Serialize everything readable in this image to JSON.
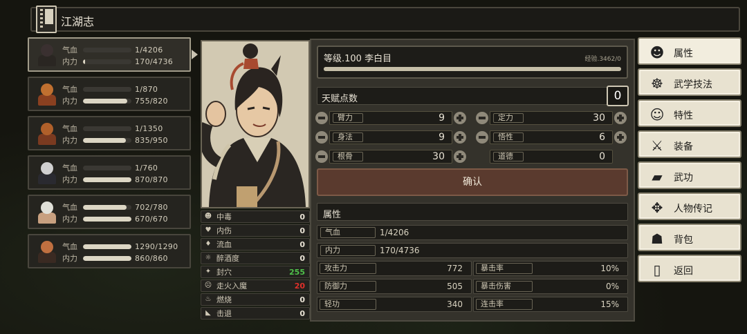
{
  "header": {
    "title": "江湖志"
  },
  "party": [
    {
      "hp_label": "气血",
      "hp": "1/4206",
      "hp_frac": 0.0,
      "mp_label": "内力",
      "mp": "170/4736",
      "mp_frac": 0.04,
      "colors": [
        "#3a3030",
        "#2a2622"
      ],
      "active": true
    },
    {
      "hp_label": "气血",
      "hp": "1/870",
      "hp_frac": 0.0,
      "mp_label": "内力",
      "mp": "755/820",
      "mp_frac": 0.92,
      "colors": [
        "#c07030",
        "#8a4020"
      ],
      "active": false
    },
    {
      "hp_label": "气血",
      "hp": "1/1350",
      "hp_frac": 0.0,
      "mp_label": "内力",
      "mp": "835/950",
      "mp_frac": 0.88,
      "colors": [
        "#b0602a",
        "#7a3a20"
      ],
      "active": false
    },
    {
      "hp_label": "气血",
      "hp": "1/760",
      "hp_frac": 0.0,
      "mp_label": "内力",
      "mp": "870/870",
      "mp_frac": 1.0,
      "colors": [
        "#d0d0d0",
        "#2a2a30"
      ],
      "active": false
    },
    {
      "hp_label": "气血",
      "hp": "702/780",
      "hp_frac": 0.9,
      "mp_label": "内力",
      "mp": "670/670",
      "mp_frac": 1.0,
      "colors": [
        "#e0e0d8",
        "#c8a080"
      ],
      "active": false
    },
    {
      "hp_label": "气血",
      "hp": "1290/1290",
      "hp_frac": 1.0,
      "mp_label": "内力",
      "mp": "860/860",
      "mp_frac": 1.0,
      "colors": [
        "#c07040",
        "#3a2a22"
      ],
      "active": false
    }
  ],
  "status": [
    {
      "icon": "poison-icon",
      "glyph": "☻",
      "label": "中毒",
      "value": "0",
      "color": "#e8e2d4"
    },
    {
      "icon": "injury-icon",
      "glyph": "♥",
      "label": "内伤",
      "value": "0",
      "color": "#e8e2d4"
    },
    {
      "icon": "bleed-icon",
      "glyph": "♦",
      "label": "流血",
      "value": "0",
      "color": "#e8e2d4"
    },
    {
      "icon": "drunk-icon",
      "glyph": "☼",
      "label": "醉酒度",
      "value": "0",
      "color": "#e8e2d4"
    },
    {
      "icon": "seal-icon",
      "glyph": "✦",
      "label": "封穴",
      "value": "255",
      "color": "#4fc04a"
    },
    {
      "icon": "qi-deviation-icon",
      "glyph": "☹",
      "label": "走火入魔",
      "value": "20",
      "color": "#e0302a"
    },
    {
      "icon": "burn-icon",
      "glyph": "♨",
      "label": "燃烧",
      "value": "0",
      "color": "#e8e2d4"
    },
    {
      "icon": "knockback-icon",
      "glyph": "◣",
      "label": "击退",
      "value": "0",
      "color": "#e8e2d4"
    }
  ],
  "main": {
    "level_text": "等级.100 李白目",
    "exp_text": "经验.3462/0",
    "exp_frac": 1.0,
    "talent_label": "天赋点数",
    "talent_value": "0",
    "stats": [
      {
        "label": "臂力",
        "value": "9"
      },
      {
        "label": "定力",
        "value": "30"
      },
      {
        "label": "身法",
        "value": "9"
      },
      {
        "label": "悟性",
        "value": "6"
      },
      {
        "label": "根骨",
        "value": "30"
      },
      {
        "label": "道德",
        "value": "0"
      }
    ],
    "confirm_label": "确认",
    "attr_header": "属性",
    "hp": {
      "label": "气血",
      "value": "1/4206"
    },
    "mp": {
      "label": "内力",
      "value": "170/4736"
    },
    "combat": [
      {
        "label": "攻击力",
        "value": "772"
      },
      {
        "label": "暴击率",
        "value": "10%"
      },
      {
        "label": "防御力",
        "value": "505"
      },
      {
        "label": "暴击伤害",
        "value": "0%"
      },
      {
        "label": "轻功",
        "value": "340"
      },
      {
        "label": "连击率",
        "value": "15%"
      }
    ]
  },
  "menu": [
    {
      "icon": "attributes-icon",
      "glyph": "☻",
      "label": "属性",
      "active": true
    },
    {
      "icon": "martial-skills-icon",
      "glyph": "☸",
      "label": "武学技法",
      "active": false
    },
    {
      "icon": "traits-icon",
      "glyph": "☺",
      "label": "特性",
      "active": false
    },
    {
      "icon": "equipment-icon",
      "glyph": "⚔",
      "label": "装备",
      "active": false
    },
    {
      "icon": "kungfu-book-icon",
      "glyph": "▰",
      "label": "武功",
      "active": false
    },
    {
      "icon": "biography-icon",
      "glyph": "✥",
      "label": "人物传记",
      "active": false
    },
    {
      "icon": "backpack-icon",
      "glyph": "☗",
      "label": "背包",
      "active": false
    },
    {
      "icon": "return-icon",
      "glyph": "▯",
      "label": "返回",
      "active": false
    }
  ]
}
